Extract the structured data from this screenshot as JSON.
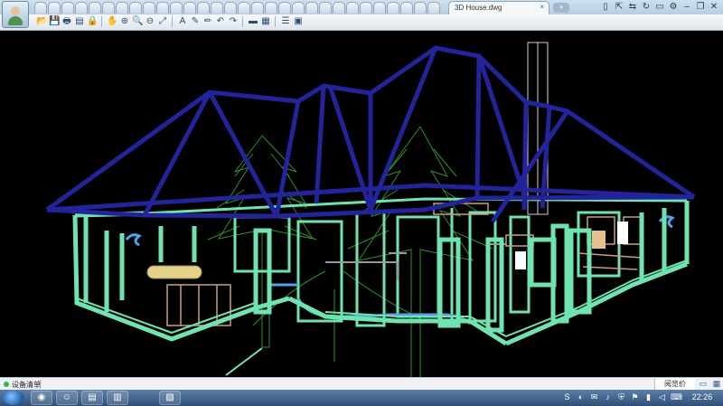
{
  "window": {
    "document_tab": "3D House.dwg",
    "close_glyph": "×",
    "new_tab_glyph": "+",
    "mini_tab_count": 30
  },
  "system_icons": [
    "phone-icon",
    "export-icon",
    "share-icon",
    "refresh-icon",
    "print-icon",
    "settings-icon",
    "minimize-icon",
    "restore-icon",
    "close-icon"
  ],
  "toolbar": {
    "tools": [
      {
        "name": "open-icon",
        "glyph": "📂"
      },
      {
        "name": "save-icon",
        "glyph": "💾"
      },
      {
        "name": "print-icon",
        "glyph": "🖶"
      },
      {
        "name": "pdf-icon",
        "glyph": "▤"
      },
      {
        "name": "lock-icon",
        "glyph": "🔒"
      },
      {
        "name": "pan-icon",
        "glyph": "✋"
      },
      {
        "name": "zoom-window-icon",
        "glyph": "⊕"
      },
      {
        "name": "zoom-in-icon",
        "glyph": "🔍"
      },
      {
        "name": "zoom-out-icon",
        "glyph": "⊖"
      },
      {
        "name": "zoom-extents-icon",
        "glyph": "⤢"
      },
      {
        "name": "text-icon",
        "glyph": "A"
      },
      {
        "name": "pen-icon",
        "glyph": "✎"
      },
      {
        "name": "marker-icon",
        "glyph": "✏"
      },
      {
        "name": "undo-icon",
        "glyph": "↶"
      },
      {
        "name": "redo-icon",
        "glyph": "↷"
      },
      {
        "name": "measure-icon",
        "glyph": "▬"
      },
      {
        "name": "hatch-icon",
        "glyph": "▦"
      },
      {
        "name": "layers-icon",
        "glyph": "☰"
      },
      {
        "name": "view-icon",
        "glyph": "▣"
      }
    ]
  },
  "status": {
    "left_label": "设备清单",
    "right_label": "阅览价"
  },
  "taskbar": {
    "clock": "22:26",
    "apps": [
      "browser-app-icon",
      "user-app-icon",
      "folder-app-icon",
      "books-app-icon",
      "charts-app-icon"
    ],
    "tray": [
      "antivirus-icon",
      "network-icon",
      "chat-icon",
      "volume-icon",
      "security-icon",
      "flag-icon",
      "battery-icon",
      "sound-icon",
      "keyboard-icon"
    ]
  },
  "colors": {
    "roof": "#23239a",
    "walls": "#6fe3b0",
    "trees": "#2f8f2f",
    "furniture": "#c8a07a",
    "pipes": "#4fa3e8",
    "chimney": "#d0d0d0"
  }
}
